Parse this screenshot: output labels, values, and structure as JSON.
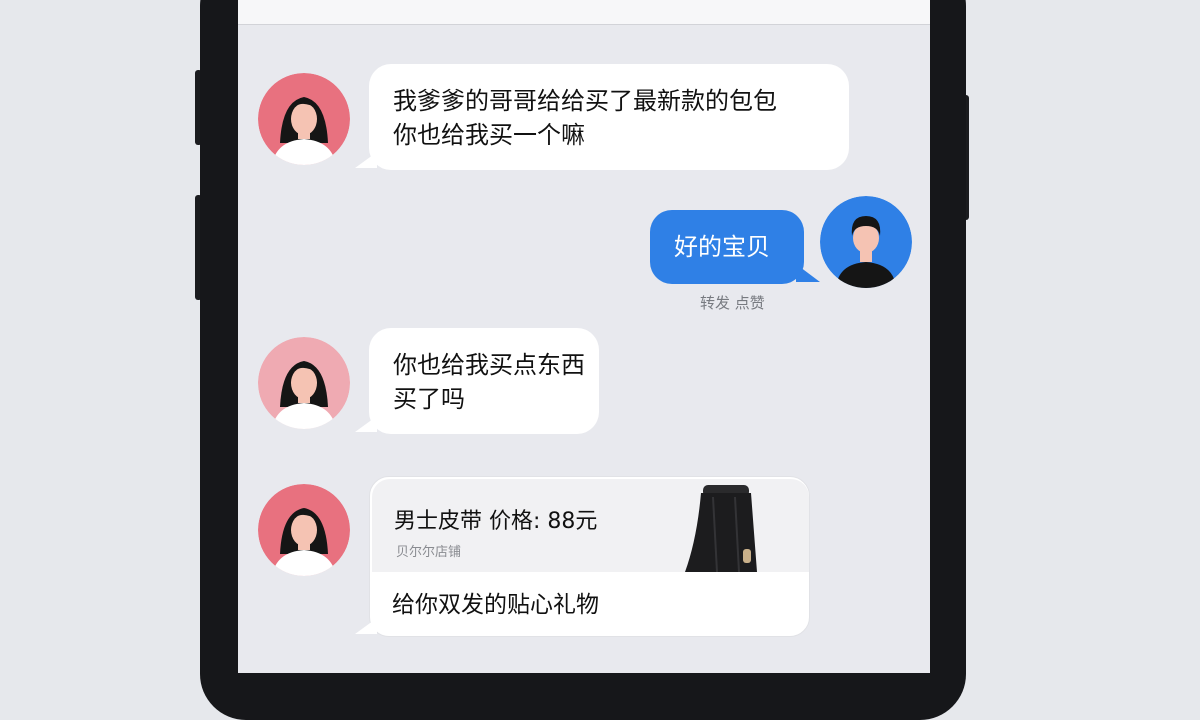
{
  "messages": [
    {
      "from": "other",
      "lines": [
        "我爹爹的哥哥给给买了最新款的包包",
        "你也给我买一个嘛"
      ]
    },
    {
      "from": "me",
      "text": "好的宝贝",
      "meta": "转发 点赞"
    },
    {
      "from": "other",
      "lines": [
        "你也给我买点东西",
        "买了吗"
      ]
    },
    {
      "from": "other",
      "type": "product",
      "product_title": "男士皮带 价格: 88元",
      "product_sub": "贝尔尔店铺",
      "caption": "给你双发的贴心礼物"
    }
  ],
  "colors": {
    "outgoing_bubble": "#2f80e6",
    "incoming_bubble": "#ffffff",
    "female_avatar_bg": "#e8717f",
    "male_avatar_bg": "#2f80e6"
  },
  "icons": {
    "female_avatar": "female-avatar-icon",
    "male_avatar": "male-avatar-icon",
    "product": "belt-product-icon"
  }
}
